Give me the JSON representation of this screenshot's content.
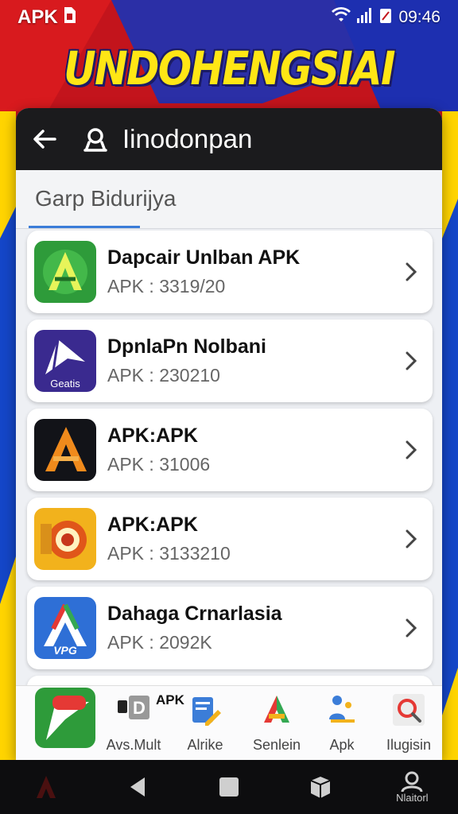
{
  "status_bar": {
    "left_label": "APK",
    "time": "09:46"
  },
  "banner": {
    "title": "UNDOHENGSIAI"
  },
  "topbar": {
    "search_query": "Iinodonpan"
  },
  "tabs": [
    {
      "label": "Garp Bidurijya"
    }
  ],
  "apps": [
    {
      "title": "Dapcair Unlban APK",
      "subtitle": "APK : 3319/20",
      "icon": "green-a-app-icon"
    },
    {
      "title": "DpnlaPn Nolbani",
      "subtitle": "APK : 230210",
      "icon": "purple-arrow-app-icon",
      "icon_text": "Geatis"
    },
    {
      "title": "APK:APK",
      "subtitle": "APK : 31006",
      "icon": "dark-orange-a-app-icon"
    },
    {
      "title": "APK:APK",
      "subtitle": "APK : 3133210",
      "icon": "gold-film-app-icon"
    },
    {
      "title": "Dahaga Crnarlasia",
      "subtitle": "APK : 2092K",
      "icon": "blue-a-app-icon",
      "icon_text": "VPG"
    }
  ],
  "dock": {
    "apk_tag": "APK",
    "items": [
      {
        "label": "Avs.Mult",
        "icon": "d-letter-icon"
      },
      {
        "label": "Alrike",
        "icon": "document-pencil-icon"
      },
      {
        "label": "Senlein",
        "icon": "multicolor-a-icon"
      },
      {
        "label": "Apk",
        "icon": "people-icon"
      },
      {
        "label": "Ilugisin",
        "icon": "gear-search-icon"
      }
    ]
  },
  "navbar": {
    "profile_label": "Nlaitorl"
  },
  "colors": {
    "accent": "#3b7dd8",
    "banner_yellow": "#ffe615",
    "topbar": "#1b1b1d"
  }
}
